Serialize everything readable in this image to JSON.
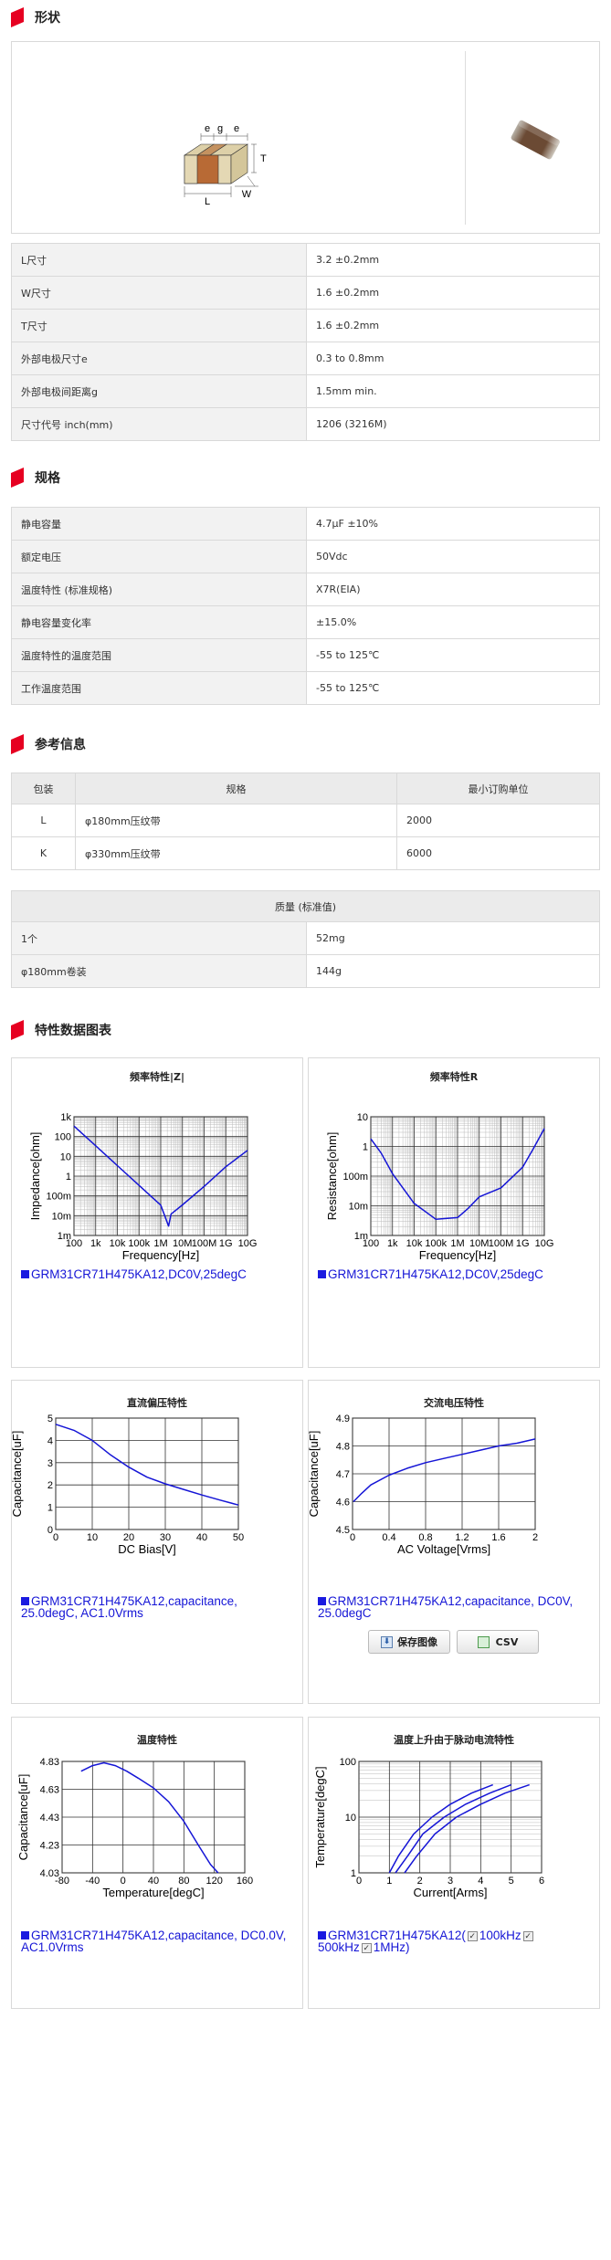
{
  "colors": {
    "accent": "#e60021",
    "series": "#1515d6"
  },
  "shape": {
    "title": "形状",
    "dims": {
      "e1": "e",
      "g": "g",
      "e2": "e",
      "t": "T",
      "l": "L",
      "w": "W"
    },
    "rows": [
      {
        "label": "L尺寸",
        "value": "3.2 ±0.2mm"
      },
      {
        "label": "W尺寸",
        "value": "1.6 ±0.2mm"
      },
      {
        "label": "T尺寸",
        "value": "1.6 ±0.2mm"
      },
      {
        "label": "外部电极尺寸e",
        "value": "0.3 to 0.8mm"
      },
      {
        "label": "外部电极间距离g",
        "value": "1.5mm min."
      },
      {
        "label": "尺寸代号 inch(mm)",
        "value": "1206 (3216M)"
      }
    ]
  },
  "spec": {
    "title": "规格",
    "rows": [
      {
        "label": "静电容量",
        "value": "4.7μF ±10%"
      },
      {
        "label": "额定电压",
        "value": "50Vdc"
      },
      {
        "label": "温度特性 (标准规格)",
        "value": "X7R(EIA)"
      },
      {
        "label": "静电容量变化率",
        "value": "±15.0%"
      },
      {
        "label": "温度特性的温度范围",
        "value": "-55 to 125℃"
      },
      {
        "label": "工作温度范围",
        "value": "-55 to 125℃"
      }
    ]
  },
  "ref": {
    "title": "参考信息",
    "pack_headers": [
      "包装",
      "规格",
      "最小订购单位"
    ],
    "pack_rows": [
      [
        "L",
        "φ180mm压纹带",
        "2000"
      ],
      [
        "K",
        "φ330mm压纹带",
        "6000"
      ]
    ],
    "mass_header": "质量 (标准值)",
    "mass_rows": [
      [
        "1个",
        "52mg"
      ],
      [
        "φ180mm卷装",
        "144g"
      ]
    ]
  },
  "charts_title": "特性数据图表",
  "charts": {
    "freq_z": {
      "title": "频率特性|Z|",
      "legend": "GRM31CR71H475KA12,DC0V,25degC"
    },
    "freq_r": {
      "title": "频率特性R",
      "legend": "GRM31CR71H475KA12,DC0V,25degC"
    },
    "dc_bias": {
      "title": "直流偏压特性",
      "legend": "GRM31CR71H475KA12,capacitance, 25.0degC, AC1.0Vrms"
    },
    "ac_volt": {
      "title": "交流电压特性",
      "legend": "GRM31CR71H475KA12,capacitance, DC0V, 25.0degC",
      "btn_save": "保存图像",
      "btn_csv": "CSV"
    },
    "temp": {
      "title": "温度特性",
      "legend": "GRM31CR71H475KA12,capacitance, DC0.0V, AC1.0Vrms"
    },
    "ripple": {
      "title": "温度上升由于脉动电流特性",
      "legend_a": "GRM31CR71H475KA12(",
      "legend_b": "100kHz",
      "legend_c": "500kHz",
      "legend_d": "1MHz)"
    }
  },
  "chart_data": [
    {
      "type": "line",
      "title": "频率特性|Z|",
      "xlabel": "Frequency[Hz]",
      "ylabel": "Impedance[ohm]",
      "xscale": "log",
      "yscale": "log",
      "xticks": [
        "100",
        "1k",
        "10k",
        "100k",
        "1M",
        "10M",
        "100M",
        "1G",
        "10G"
      ],
      "yticks": [
        "1m",
        "10m",
        "100m",
        "1",
        "10",
        "100",
        "1k"
      ],
      "x": [
        100,
        1000,
        10000,
        100000,
        1000000,
        2300000,
        3000000,
        10000000,
        100000000,
        1000000000,
        10000000000
      ],
      "y": [
        340,
        34,
        3.4,
        0.34,
        0.034,
        0.003,
        0.012,
        0.035,
        0.3,
        3,
        20
      ],
      "series": [
        {
          "name": "GRM31CR71H475KA12,DC0V,25degC"
        }
      ]
    },
    {
      "type": "line",
      "title": "频率特性R",
      "xlabel": "Frequency[Hz]",
      "ylabel": "Resistance[ohm]",
      "xscale": "log",
      "yscale": "log",
      "xticks": [
        "100",
        "1k",
        "10k",
        "100k",
        "1M",
        "10M",
        "100M",
        "1G",
        "10G"
      ],
      "yticks": [
        "1m",
        "10m",
        "100m",
        "1",
        "10"
      ],
      "x": [
        100,
        300,
        1000,
        10000,
        100000,
        1000000,
        3000000,
        10000000,
        100000000,
        1000000000,
        3000000000,
        10000000000
      ],
      "y": [
        1.8,
        0.6,
        0.12,
        0.012,
        0.0035,
        0.004,
        0.008,
        0.02,
        0.04,
        0.2,
        0.8,
        4
      ],
      "series": [
        {
          "name": "GRM31CR71H475KA12,DC0V,25degC"
        }
      ]
    },
    {
      "type": "line",
      "title": "直流偏压特性",
      "xlabel": "DC Bias[V]",
      "ylabel": "Capacitance[uF]",
      "xlim": [
        0,
        50
      ],
      "ylim": [
        0,
        5
      ],
      "xticks": [
        "0",
        "10",
        "20",
        "30",
        "40",
        "50"
      ],
      "yticks": [
        "0",
        "1",
        "2",
        "3",
        "4",
        "5"
      ],
      "x": [
        0,
        5,
        10,
        15,
        20,
        25,
        30,
        35,
        40,
        45,
        50
      ],
      "y": [
        4.72,
        4.45,
        4.0,
        3.35,
        2.8,
        2.35,
        2.05,
        1.8,
        1.55,
        1.32,
        1.1
      ],
      "series": [
        {
          "name": "GRM31CR71H475KA12,capacitance, 25.0degC, AC1.0Vrms"
        }
      ]
    },
    {
      "type": "line",
      "title": "交流电压特性",
      "xlabel": "AC Voltage[Vrms]",
      "ylabel": "Capacitance[uF]",
      "xlim": [
        0,
        2
      ],
      "ylim": [
        4.5,
        4.9
      ],
      "xticks": [
        "0",
        "0.4",
        "0.8",
        "1.2",
        "1.6",
        "2"
      ],
      "yticks": [
        "4.5",
        "4.6",
        "4.7",
        "4.8",
        "4.9"
      ],
      "x": [
        0.01,
        0.1,
        0.2,
        0.4,
        0.6,
        0.8,
        1.0,
        1.2,
        1.4,
        1.6,
        1.8,
        2.0
      ],
      "y": [
        4.6,
        4.63,
        4.66,
        4.695,
        4.72,
        4.74,
        4.755,
        4.77,
        4.785,
        4.8,
        4.81,
        4.825
      ],
      "series": [
        {
          "name": "GRM31CR71H475KA12,capacitance, DC0V, 25.0degC"
        }
      ]
    },
    {
      "type": "line",
      "title": "温度特性",
      "xlabel": "Temperature[degC]",
      "ylabel": "Capacitance[uF]",
      "xlim": [
        -80,
        160
      ],
      "ylim": [
        4.03,
        4.83
      ],
      "xticks": [
        "-80",
        "-40",
        "0",
        "40",
        "80",
        "120",
        "160"
      ],
      "yticks": [
        "4.03",
        "4.23",
        "4.43",
        "4.63",
        "4.83"
      ],
      "x": [
        -55,
        -40,
        -25,
        -10,
        5,
        20,
        40,
        60,
        80,
        100,
        115,
        125
      ],
      "y": [
        4.76,
        4.8,
        4.82,
        4.8,
        4.76,
        4.71,
        4.64,
        4.54,
        4.4,
        4.22,
        4.09,
        4.03
      ],
      "series": [
        {
          "name": "GRM31CR71H475KA12,capacitance, DC0.0V, AC1.0Vrms"
        }
      ]
    },
    {
      "type": "line",
      "title": "温度上升由于脉动电流特性",
      "xlabel": "Current[Arms]",
      "ylabel": "Temperature[degC]",
      "xlim": [
        0,
        6
      ],
      "ylim": [
        1,
        100
      ],
      "yscale": "log",
      "xticks": [
        "0",
        "1",
        "2",
        "3",
        "4",
        "5",
        "6"
      ],
      "yticks": [
        "1",
        "10",
        "100"
      ],
      "series": [
        {
          "name": "100kHz",
          "x": [
            1.0,
            1.3,
            1.8,
            2.4,
            3.0,
            3.7,
            4.4
          ],
          "y": [
            1,
            2,
            5,
            10,
            17,
            27,
            38
          ]
        },
        {
          "name": "500kHz",
          "x": [
            1.2,
            1.6,
            2.1,
            2.8,
            3.5,
            4.3,
            5.0
          ],
          "y": [
            1,
            2,
            5,
            10,
            17,
            27,
            38
          ]
        },
        {
          "name": "1MHz",
          "x": [
            1.5,
            1.9,
            2.5,
            3.2,
            4.0,
            4.8,
            5.6
          ],
          "y": [
            1,
            2,
            5,
            10,
            17,
            27,
            38
          ]
        }
      ]
    }
  ]
}
